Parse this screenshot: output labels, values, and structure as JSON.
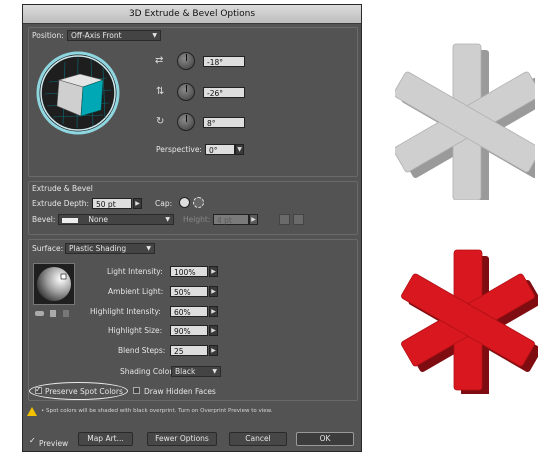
{
  "dialog": {
    "title": "3D Extrude & Bevel Options",
    "position": {
      "label": "Position:",
      "value": "Off-Axis Front",
      "rotation_x": "-18°",
      "rotation_y": "-26°",
      "rotation_z": "8°",
      "perspective_label": "Perspective:",
      "perspective_value": "0°"
    },
    "extrude": {
      "section_title": "Extrude & Bevel",
      "depth_label": "Extrude Depth:",
      "depth_value": "50 pt",
      "cap_label": "Cap:",
      "bevel_label": "Bevel:",
      "bevel_value": "None",
      "height_label": "Height:",
      "height_value": "4 pt"
    },
    "surface": {
      "label": "Surface:",
      "value": "Plastic Shading",
      "rows": [
        {
          "label": "Light Intensity:",
          "value": "100%"
        },
        {
          "label": "Ambient Light:",
          "value": "50%"
        },
        {
          "label": "Highlight Intensity:",
          "value": "60%"
        },
        {
          "label": "Highlight Size:",
          "value": "90%"
        },
        {
          "label": "Blend Steps:",
          "value": "25"
        }
      ],
      "shading_color_label": "Shading Color:",
      "shading_color_value": "Black"
    },
    "options": {
      "preserve_spot": "Preserve Spot Colors",
      "draw_hidden": "Draw Hidden Faces",
      "warning": "• Spot colors will be shaded with black overprint. Turn on Overprint Preview to view."
    },
    "buttons": {
      "preview": "Preview",
      "map_art": "Map Art...",
      "fewer_options": "Fewer Options",
      "cancel": "Cancel",
      "ok": "OK"
    }
  },
  "colors": {
    "cube_front": "#00a7b5",
    "gray_asterisk": "#c8c8c8",
    "red_asterisk": "#d8171f"
  },
  "icons": [
    "rotate-x-icon",
    "rotate-y-icon",
    "rotate-z-icon",
    "cap-on-icon",
    "cap-off-icon",
    "warning-icon",
    "light-sphere-icon"
  ]
}
